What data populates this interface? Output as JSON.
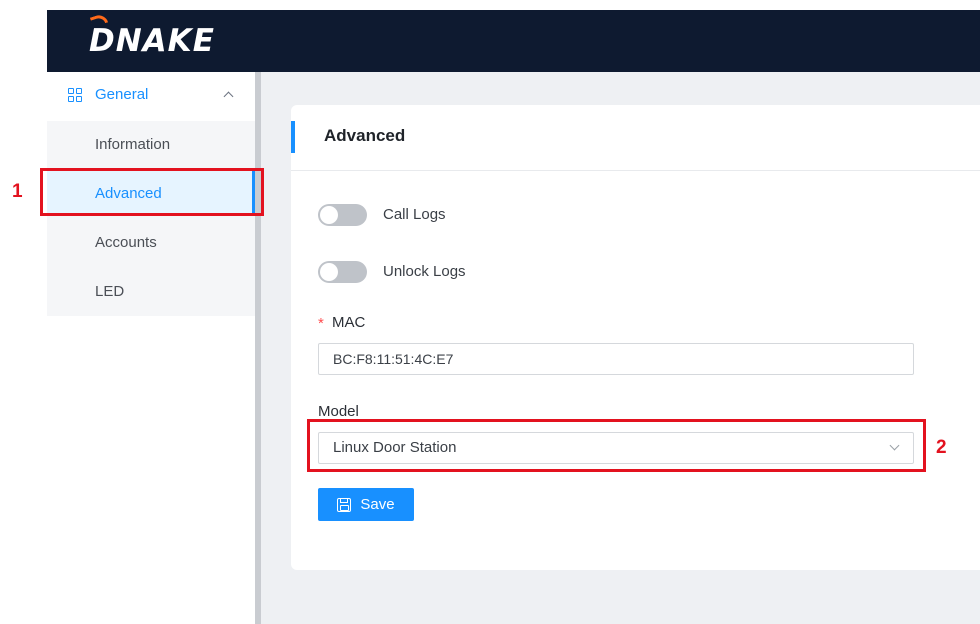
{
  "header": {
    "logo_text": "DNAKE"
  },
  "sidebar": {
    "group_label": "General",
    "group_icon": "grid-icon",
    "items": [
      {
        "label": "Information",
        "active": false
      },
      {
        "label": "Advanced",
        "active": true
      },
      {
        "label": "Accounts",
        "active": false
      },
      {
        "label": "LED",
        "active": false
      }
    ]
  },
  "panel": {
    "title": "Advanced",
    "toggles": [
      {
        "label": "Call Logs",
        "on": false
      },
      {
        "label": "Unlock Logs",
        "on": false
      }
    ],
    "mac": {
      "required_mark": "*",
      "label": "MAC",
      "value": "BC:F8:11:51:4C:E7"
    },
    "model": {
      "label": "Model",
      "selected": "Linux Door Station"
    },
    "save_label": "Save"
  },
  "annotations": [
    {
      "number": "1",
      "target": "Advanced"
    },
    {
      "number": "2",
      "target": "Model"
    }
  ],
  "colors": {
    "accent": "#1890ff",
    "header_bg": "#0e1a30",
    "logo_arc": "#ff6a1a",
    "annotation": "#e3121f"
  }
}
